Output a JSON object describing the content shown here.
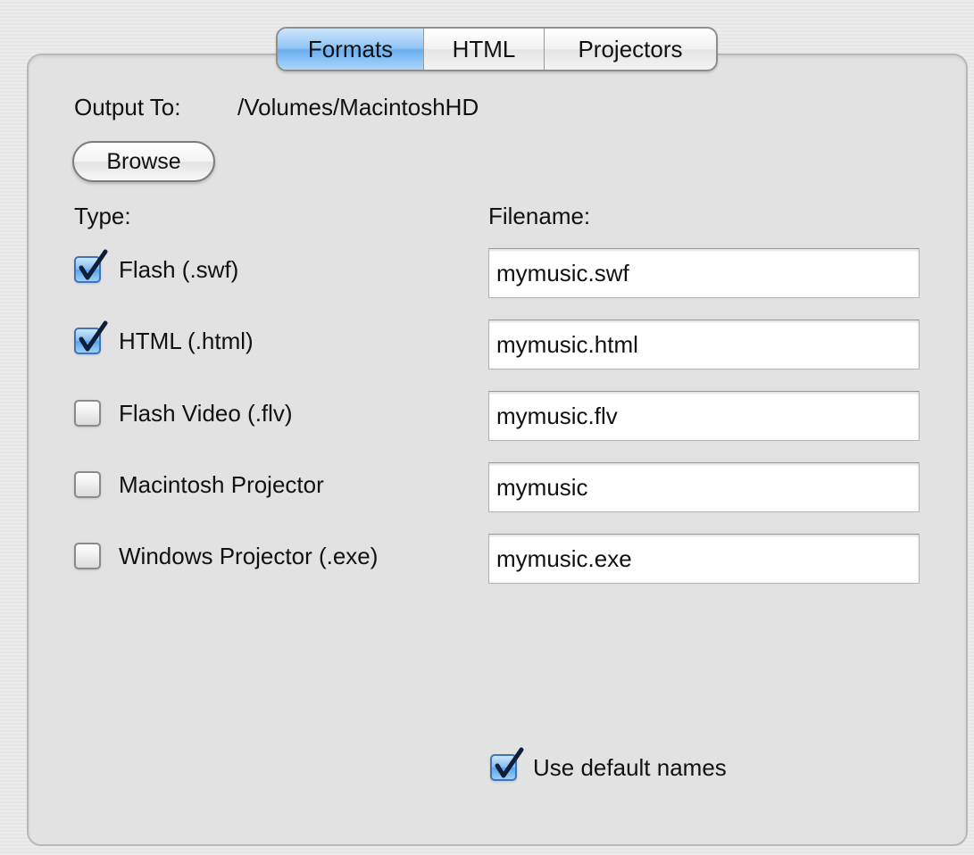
{
  "tabs": [
    {
      "label": "Formats",
      "selected": true
    },
    {
      "label": "HTML",
      "selected": false
    },
    {
      "label": "Projectors",
      "selected": false
    }
  ],
  "output": {
    "label": "Output To:",
    "path": "/Volumes/MacintoshHD"
  },
  "browse_label": "Browse",
  "columns": {
    "type_label": "Type:",
    "filename_label": "Filename:"
  },
  "formats": [
    {
      "label": "Flash (.swf)",
      "checked": true,
      "filename": "mymusic.swf"
    },
    {
      "label": "HTML (.html)",
      "checked": true,
      "filename": "mymusic.html"
    },
    {
      "label": "Flash Video (.flv)",
      "checked": false,
      "filename": "mymusic.flv"
    },
    {
      "label": "Macintosh Projector",
      "checked": false,
      "filename": "mymusic"
    },
    {
      "label": "Windows Projector (.exe)",
      "checked": false,
      "filename": "mymusic.exe"
    }
  ],
  "default_names": {
    "label": "Use default names",
    "checked": true
  },
  "colors": {
    "accent": "#6aaef0",
    "panel": "#e2e2e2"
  }
}
